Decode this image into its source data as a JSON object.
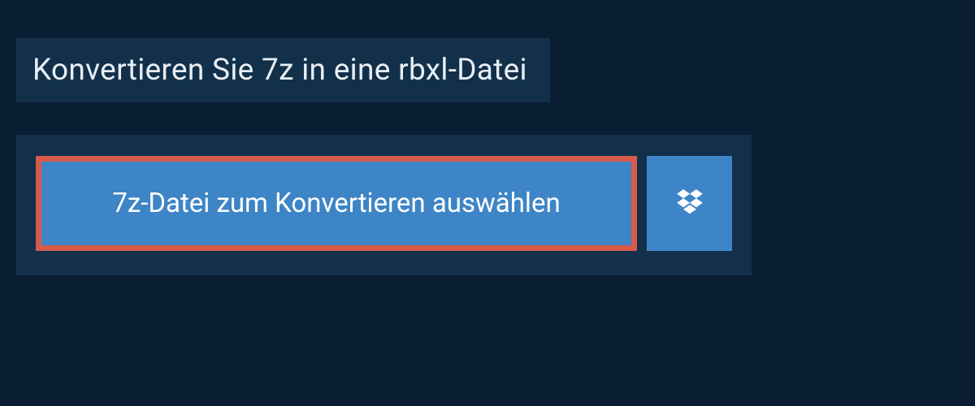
{
  "header": {
    "title": "Konvertieren Sie 7z in eine rbxl-Datei"
  },
  "actions": {
    "select_file_label": "7z-Datei zum Konvertieren auswählen"
  },
  "colors": {
    "background": "#0a1e33",
    "panel": "#12304a",
    "button": "#3d85c6",
    "highlight": "#d75a4a"
  }
}
